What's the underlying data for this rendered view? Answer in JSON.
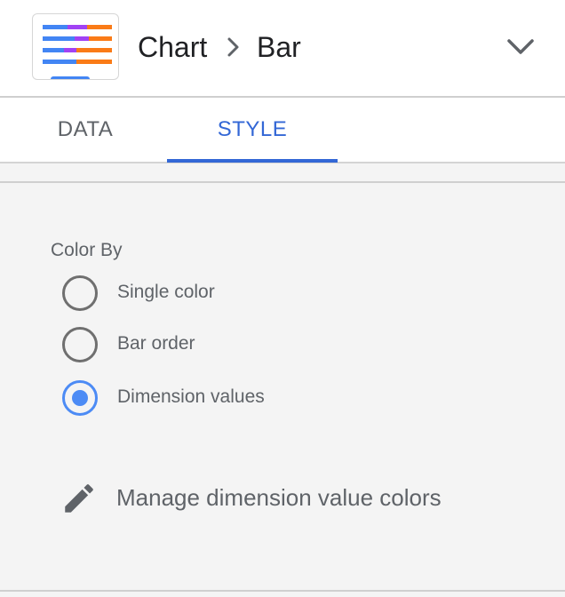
{
  "header": {
    "breadcrumb": {
      "root": "Chart",
      "current": "Bar"
    },
    "thumbnail_icon": "bar-chart-thumbnail-icon",
    "collapse_icon": "chevron-down-icon"
  },
  "tabs": [
    {
      "label": "DATA",
      "active": false
    },
    {
      "label": "STYLE",
      "active": true
    }
  ],
  "color_by": {
    "label": "Color By",
    "options": [
      {
        "label": "Single color",
        "selected": false
      },
      {
        "label": "Bar order",
        "selected": false
      },
      {
        "label": "Dimension values",
        "selected": true
      }
    ]
  },
  "manage_colors": {
    "label": "Manage dimension value colors",
    "icon": "pencil-icon"
  },
  "colors": {
    "accent": "#3367d6",
    "radio_selected": "#4c8bf5",
    "bar_blue": "#4285f4",
    "bar_orange": "#fa7b17",
    "bar_purple": "#a142f4"
  }
}
